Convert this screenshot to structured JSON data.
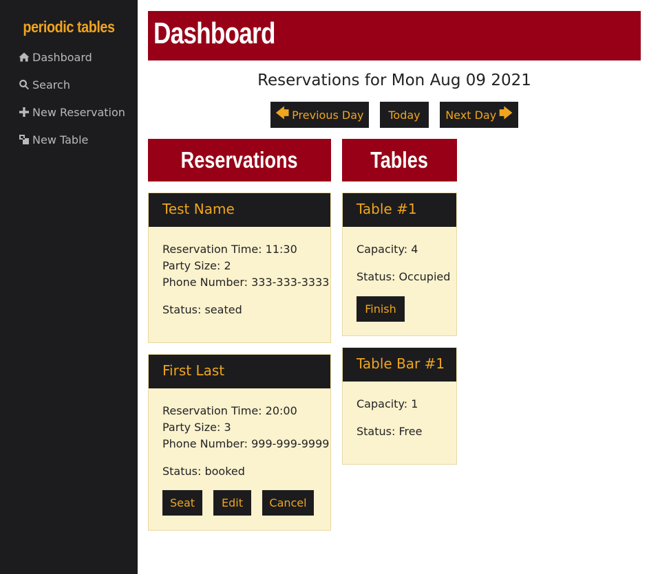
{
  "sidebar": {
    "brand": "periodic tables",
    "items": [
      {
        "label": "Dashboard",
        "icon": "home-icon"
      },
      {
        "label": "Search",
        "icon": "search-icon"
      },
      {
        "label": "New Reservation",
        "icon": "plus-icon"
      },
      {
        "label": "New Table",
        "icon": "tables-icon"
      }
    ]
  },
  "header": {
    "title": "Dashboard"
  },
  "date_heading": "Reservations for Mon Aug 09 2021",
  "day_nav": {
    "previous_label": "Previous Day",
    "today_label": "Today",
    "next_label": "Next Day",
    "arrow_left": "🡄",
    "arrow_right": "🡆"
  },
  "sections": {
    "reservations": "Reservations",
    "tables": "Tables"
  },
  "reservations": [
    {
      "name": "Test Name",
      "time": "Reservation Time: 11:30",
      "party": "Party Size: 2",
      "phone": "Phone Number: 333-333-3333",
      "status": "Status: seated"
    },
    {
      "name": "First Last",
      "time": "Reservation Time: 20:00",
      "party": "Party Size: 3",
      "phone": "Phone Number: 999-999-9999",
      "status": "Status: booked",
      "actions": {
        "seat": "Seat",
        "edit": "Edit",
        "cancel": "Cancel"
      }
    }
  ],
  "tables": [
    {
      "name": "Table #1",
      "capacity": "Capacity: 4",
      "status": "Status: Occupied",
      "action": "Finish"
    },
    {
      "name": "Table Bar #1",
      "capacity": "Capacity: 1",
      "status": "Status: Free"
    }
  ],
  "colors": {
    "accent": "#f0a51e",
    "brand_red": "#970016",
    "dark": "#1c1c1e",
    "card_bg": "#fbf2ce"
  }
}
